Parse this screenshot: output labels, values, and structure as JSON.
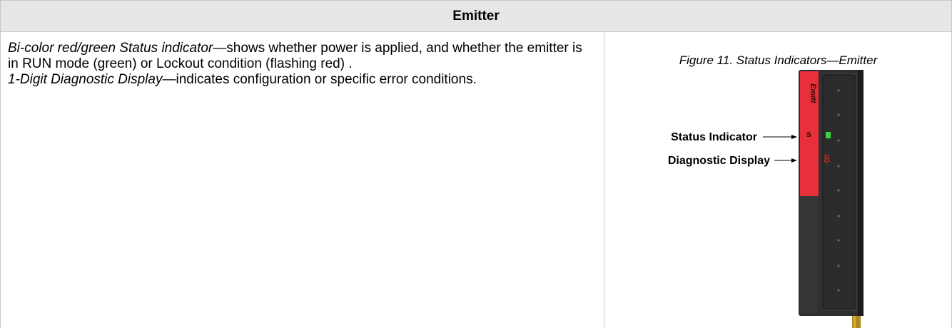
{
  "table": {
    "header": "Emitter"
  },
  "description": {
    "status_term": "Bi-color red/green Status indicator",
    "status_text": "—shows whether power is applied, and whether the emitter is in RUN mode (green) or Lockout condition (flashing red) .",
    "diag_term": "1-Digit Diagnostic Display",
    "diag_text": "—indicates configuration or specific error conditions."
  },
  "figure": {
    "caption": "Figure 11. Status Indicators—Emitter",
    "callouts": {
      "status": "Status Indicator",
      "diagnostic": "Diagnostic Display"
    },
    "device_label": "Emitt",
    "status_letter": "S",
    "digit": "8",
    "colors": {
      "housing_red": "#e8303c",
      "housing_dark": "#2b2b2b",
      "led_green": "#3cd23c",
      "digit_red": "#d82828",
      "cable": "#b08a1e"
    }
  }
}
